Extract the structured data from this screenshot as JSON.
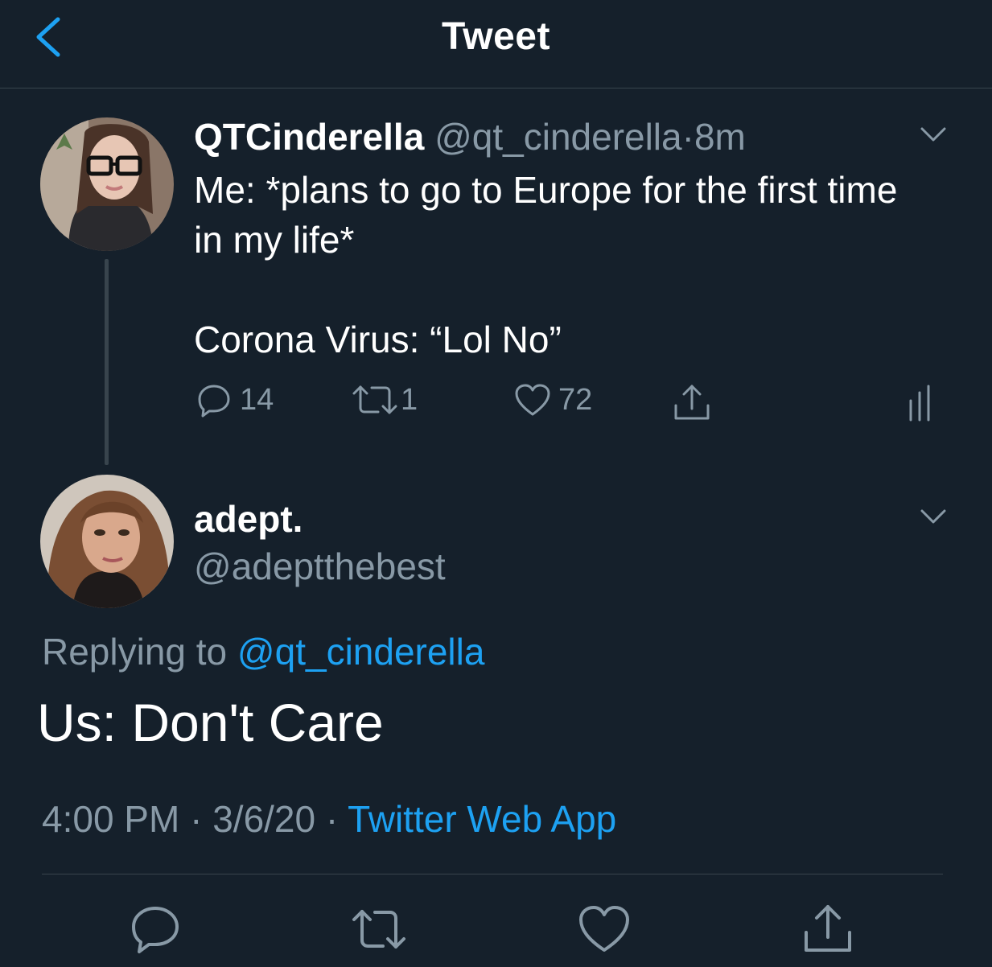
{
  "header": {
    "title": "Tweet",
    "back_icon": "chevron-left-icon"
  },
  "parent_tweet": {
    "display_name": "QTCinderella",
    "handle": "@qt_cinderella",
    "separator": "·",
    "time": "8m",
    "text_line_1": "Me: *plans to go to Europe for the first time in my life*",
    "text_line_2": "Corona Virus: “Lol No”",
    "reply_count": "14",
    "retweet_count": "1",
    "like_count": "72"
  },
  "reply_tweet": {
    "display_name": "adept.",
    "handle": "@adeptthebest",
    "replying_prefix": "Replying to",
    "replying_handle": "@qt_cinderella",
    "text": "Us: Don't Care",
    "time": "4:00 PM",
    "date": "3/6/20",
    "separator": "·",
    "source": "Twitter Web App"
  },
  "colors": {
    "background": "#15202b",
    "accent": "#1da1f2",
    "secondary_text": "#8899a6",
    "divider": "#38444d"
  }
}
